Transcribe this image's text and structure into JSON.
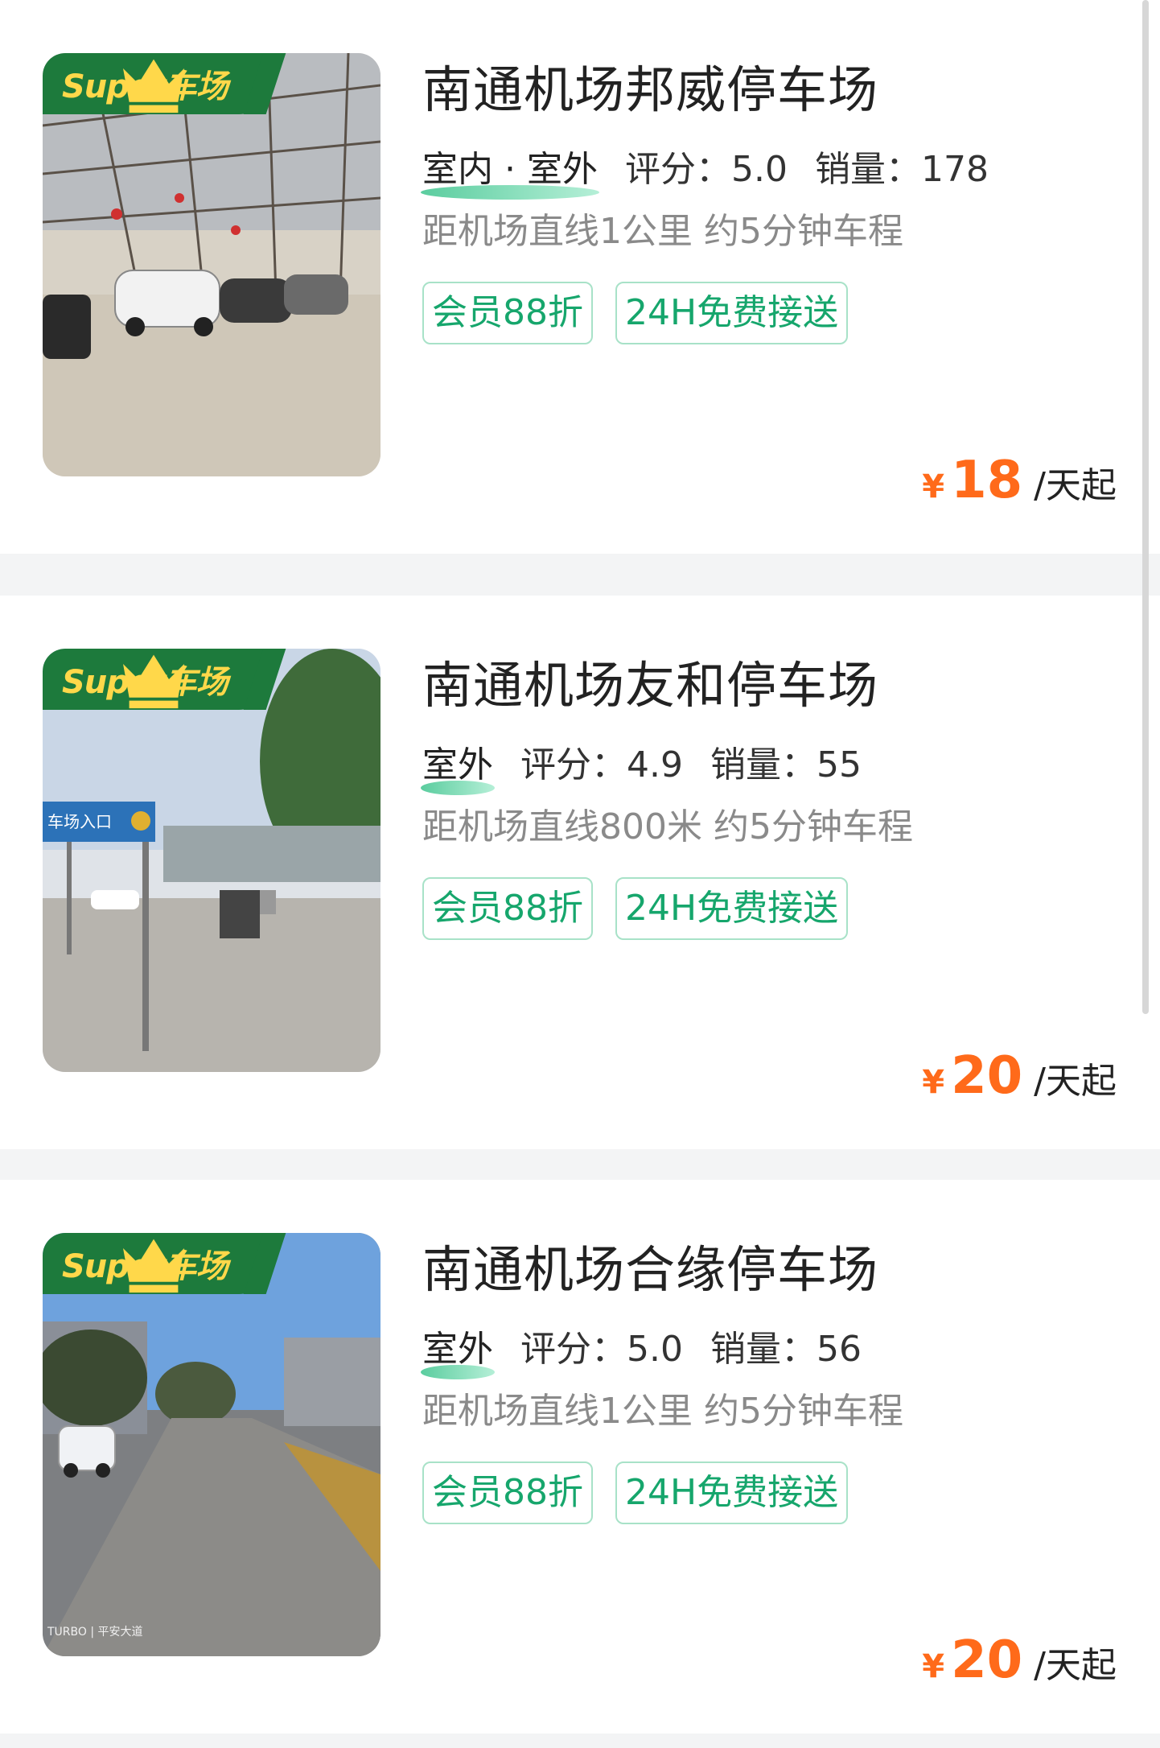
{
  "listings": [
    {
      "badge": "Super车场",
      "title": "南通机场邦威停车场",
      "env": "室内 · 室外",
      "rating_label": "评分：",
      "rating": "5.0",
      "sales_label": "销量：",
      "sales": "178",
      "distance": "距机场直线1公里 约5分钟车程",
      "tags": [
        "会员88折",
        "24H免费接送"
      ],
      "currency": "¥",
      "price": "18",
      "unit": "/天起",
      "photo": "indoor-parking-lot-photo"
    },
    {
      "badge": "Super车场",
      "title": "南通机场友和停车场",
      "env": "室外",
      "rating_label": "评分：",
      "rating": "4.9",
      "sales_label": "销量：",
      "sales": "55",
      "distance": "距机场直线800米 约5分钟车程",
      "tags": [
        "会员88折",
        "24H免费接送"
      ],
      "currency": "¥",
      "price": "20",
      "unit": "/天起",
      "photo": "parking-entrance-photo",
      "sign_text": "车场入口"
    },
    {
      "badge": "Super车场",
      "title": "南通机场合缘停车场",
      "env": "室外",
      "rating_label": "评分：",
      "rating": "5.0",
      "sales_label": "销量：",
      "sales": "56",
      "distance": "距机场直线1公里 约5分钟车程",
      "tags": [
        "会员88折",
        "24H免费接送"
      ],
      "currency": "¥",
      "price": "20",
      "unit": "/天起",
      "photo": "outdoor-road-photo",
      "watermark": "TURBO | 平安大道"
    }
  ],
  "colors": {
    "accent_green": "#16a66c",
    "badge_green": "#1d7a3c",
    "badge_gold": "#ffd84a",
    "price_orange": "#ff6a1a",
    "separator": "#f3f4f5"
  }
}
